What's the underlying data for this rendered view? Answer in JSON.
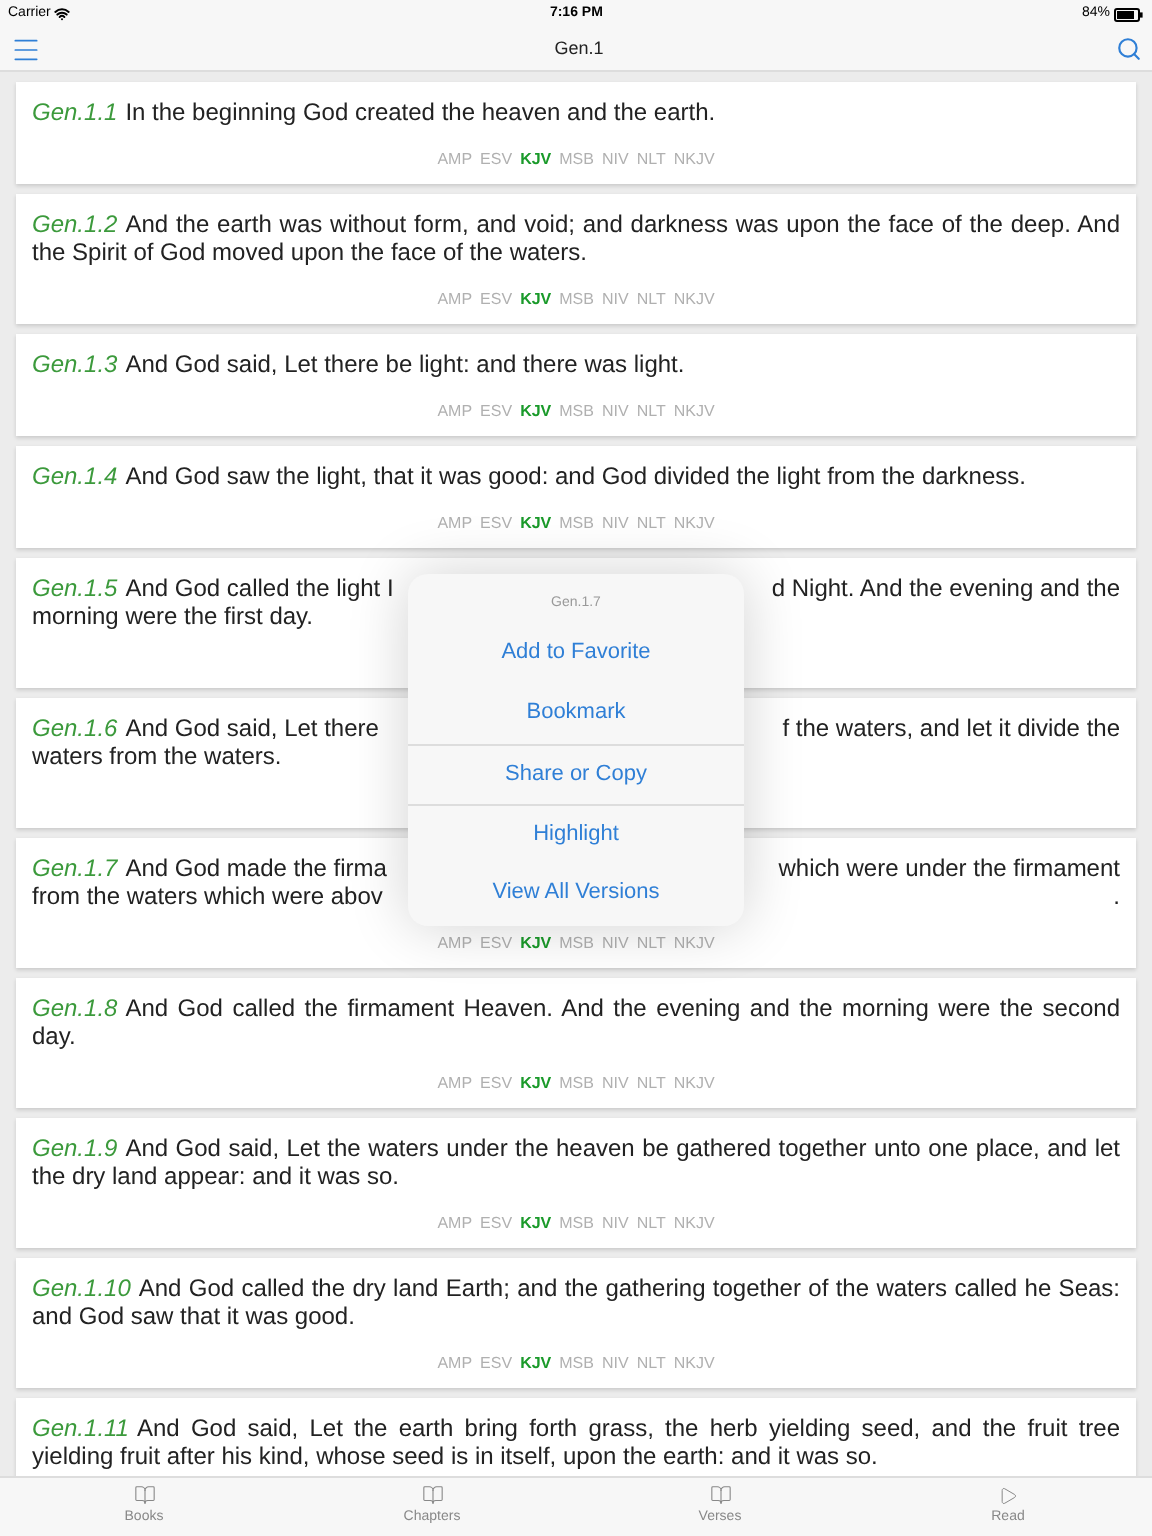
{
  "status_bar": {
    "carrier": "Carrier",
    "time": "7:16 PM",
    "battery": "84%"
  },
  "nav": {
    "title": "Gen.1"
  },
  "verses": [
    {
      "ref": "Gen.1.1",
      "text": "In the beginning God created the heaven and the earth.",
      "versions": [
        {
          "label": "AMP",
          "selected": false
        },
        {
          "label": "ESV",
          "selected": false
        },
        {
          "label": "KJV",
          "selected": true
        },
        {
          "label": "MSB",
          "selected": false
        },
        {
          "label": "NIV",
          "selected": false
        },
        {
          "label": "NLT",
          "selected": false
        },
        {
          "label": "NKJV",
          "selected": false
        }
      ]
    },
    {
      "ref": "Gen.1.2",
      "text": "And the earth was without form, and void; and darkness was upon the face of the deep. And the Spirit of God moved upon the face of the waters.",
      "versions": [
        {
          "label": "AMP",
          "selected": false
        },
        {
          "label": "ESV",
          "selected": false
        },
        {
          "label": "KJV",
          "selected": true
        },
        {
          "label": "MSB",
          "selected": false
        },
        {
          "label": "NIV",
          "selected": false
        },
        {
          "label": "NLT",
          "selected": false
        },
        {
          "label": "NKJV",
          "selected": false
        }
      ]
    },
    {
      "ref": "Gen.1.3",
      "text": "And God said, Let there be light: and there was light.",
      "versions": [
        {
          "label": "AMP",
          "selected": false
        },
        {
          "label": "ESV",
          "selected": false
        },
        {
          "label": "KJV",
          "selected": true
        },
        {
          "label": "MSB",
          "selected": false
        },
        {
          "label": "NIV",
          "selected": false
        },
        {
          "label": "NLT",
          "selected": false
        },
        {
          "label": "NKJV",
          "selected": false
        }
      ]
    },
    {
      "ref": "Gen.1.4",
      "text": "And God saw the light, that it was good: and God divided the light from the darkness.",
      "versions": [
        {
          "label": "AMP",
          "selected": false
        },
        {
          "label": "ESV",
          "selected": false
        },
        {
          "label": "KJV",
          "selected": true
        },
        {
          "label": "MSB",
          "selected": false
        },
        {
          "label": "NIV",
          "selected": false
        },
        {
          "label": "NLT",
          "selected": false
        },
        {
          "label": "NKJV",
          "selected": false
        }
      ]
    },
    {
      "ref": "Gen.1.5",
      "lines": [
        {
          "left": "And God called the light I",
          "right": "d Night. And the evening and the"
        },
        {
          "left": "morning were the first day."
        }
      ]
    },
    {
      "ref": "Gen.1.6",
      "lines": [
        {
          "left": "And God said, Let there",
          "right": "f the waters, and let it divide the"
        },
        {
          "left": "waters from the waters."
        }
      ]
    },
    {
      "ref": "Gen.1.7",
      "lines": [
        {
          "left": "And God made the firma",
          "right": "which were under the firmament"
        },
        {
          "left": "from the waters which were abov",
          "right": "."
        }
      ],
      "versions": [
        {
          "label": "AMP",
          "selected": false
        },
        {
          "label": "ESV",
          "selected": false
        },
        {
          "label": "KJV",
          "selected": true
        },
        {
          "label": "MSB",
          "selected": false
        },
        {
          "label": "NIV",
          "selected": false
        },
        {
          "label": "NLT",
          "selected": false
        },
        {
          "label": "NKJV",
          "selected": false
        }
      ]
    },
    {
      "ref": "Gen.1.8",
      "text": "And God called the firmament Heaven. And the evening and the morning were the second day.",
      "versions": [
        {
          "label": "AMP",
          "selected": false
        },
        {
          "label": "ESV",
          "selected": false
        },
        {
          "label": "KJV",
          "selected": true
        },
        {
          "label": "MSB",
          "selected": false
        },
        {
          "label": "NIV",
          "selected": false
        },
        {
          "label": "NLT",
          "selected": false
        },
        {
          "label": "NKJV",
          "selected": false
        }
      ]
    },
    {
      "ref": "Gen.1.9",
      "text": "And God said, Let the waters under the heaven be gathered together unto one place, and let the dry land appear: and it was so.",
      "versions": [
        {
          "label": "AMP",
          "selected": false
        },
        {
          "label": "ESV",
          "selected": false
        },
        {
          "label": "KJV",
          "selected": true
        },
        {
          "label": "MSB",
          "selected": false
        },
        {
          "label": "NIV",
          "selected": false
        },
        {
          "label": "NLT",
          "selected": false
        },
        {
          "label": "NKJV",
          "selected": false
        }
      ]
    },
    {
      "ref": "Gen.1.10",
      "text": "And God called the dry land Earth; and the gathering together of the waters called he Seas: and God saw that it was good.",
      "versions": [
        {
          "label": "AMP",
          "selected": false
        },
        {
          "label": "ESV",
          "selected": false
        },
        {
          "label": "KJV",
          "selected": true
        },
        {
          "label": "MSB",
          "selected": false
        },
        {
          "label": "NIV",
          "selected": false
        },
        {
          "label": "NLT",
          "selected": false
        },
        {
          "label": "NKJV",
          "selected": false
        }
      ]
    },
    {
      "ref": "Gen.1.11",
      "text": "And God said, Let the earth bring forth grass, the herb yielding seed, and the fruit tree yielding fruit after his kind, whose seed is in itself, upon the earth: and it was so."
    }
  ],
  "popup": {
    "title": "Gen.1.7",
    "actions": [
      {
        "label": "Add to Favorite",
        "divider_above": false
      },
      {
        "label": "Bookmark",
        "divider_above": false
      },
      {
        "label": "Share or Copy",
        "divider_above": true
      },
      {
        "label": "Highlight",
        "divider_above": true
      },
      {
        "label": "View All Versions",
        "divider_above": false
      }
    ]
  },
  "tabs": [
    {
      "label": "Books",
      "kind": "book",
      "selected": false
    },
    {
      "label": "Chapters",
      "kind": "book",
      "selected": false
    },
    {
      "label": "Verses",
      "kind": "book",
      "selected": false
    },
    {
      "label": "Read",
      "kind": "play",
      "selected": false
    }
  ]
}
